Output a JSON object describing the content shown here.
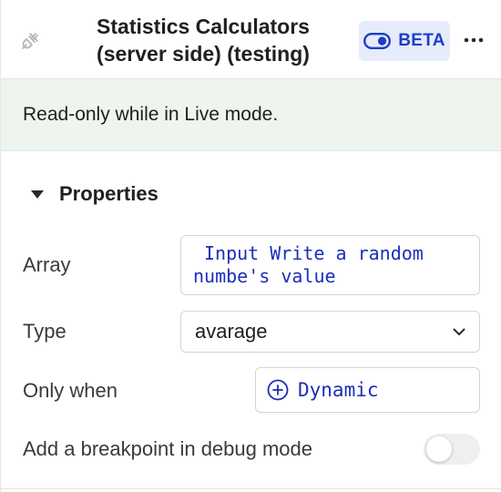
{
  "header": {
    "title_line1": "Statistics Calculators",
    "title_line2": "(server side) (testing)",
    "beta_label": "BETA",
    "more_label": "⋯"
  },
  "notice": {
    "text": "Read-only while in Live mode."
  },
  "properties": {
    "section_title": "Properties",
    "array": {
      "label": "Array",
      "value_line1": "Input Write a random",
      "value_line2": "numbe's value"
    },
    "type": {
      "label": "Type",
      "selected": "avarage"
    },
    "only_when": {
      "label": "Only when",
      "value": "Dynamic"
    },
    "breakpoint": {
      "label": "Add a breakpoint in debug mode",
      "enabled": false
    }
  },
  "colors": {
    "accent_blue": "#1d3ec9",
    "notice_bg": "#eef5ee",
    "beta_bg": "#e6ecfb"
  }
}
